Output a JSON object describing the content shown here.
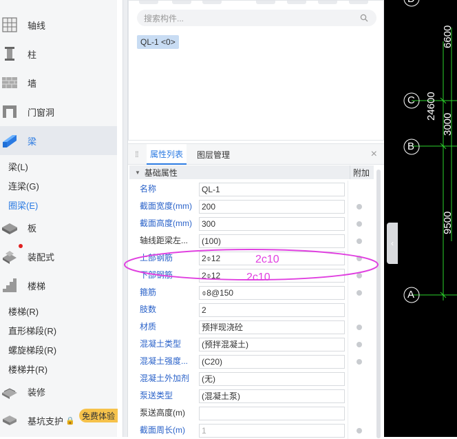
{
  "nav": {
    "items": [
      {
        "label": "轴线",
        "icon": "axis-grid-icon"
      },
      {
        "label": "柱",
        "icon": "column-icon"
      },
      {
        "label": "墙",
        "icon": "wall-icon"
      },
      {
        "label": "门窗洞",
        "icon": "door-window-icon"
      },
      {
        "label": "梁",
        "icon": "beam-icon"
      },
      {
        "label": "板",
        "icon": "slab-icon"
      },
      {
        "label": "装配式",
        "icon": "prefab-icon"
      },
      {
        "label": "楼梯",
        "icon": "stairs-icon"
      },
      {
        "label": "装修",
        "icon": "decoration-icon"
      },
      {
        "label": "基坑支护",
        "icon": "pit-support-icon"
      }
    ],
    "beam_subs": [
      "梁(L)",
      "连梁(G)",
      "圈梁(E)"
    ],
    "stair_subs": [
      "楼梯(R)",
      "直形梯段(R)",
      "螺旋梯段(R)",
      "楼梯井(R)"
    ],
    "lock_glyph": "🔒",
    "free_badge": "免费体验"
  },
  "component_panel": {
    "search_placeholder": "搜索构件...",
    "item": "QL-1 <0>"
  },
  "properties": {
    "tabs": [
      "属性列表",
      "图层管理"
    ],
    "close": "×",
    "group_label": "基础属性",
    "extra_col": "附加",
    "rows": [
      {
        "label": "名称",
        "value": "QL-1",
        "check": false,
        "dark": false
      },
      {
        "label": "截面宽度(mm)",
        "value": "200",
        "check": true,
        "dark": false
      },
      {
        "label": "截面高度(mm)",
        "value": "300",
        "check": true,
        "dark": false
      },
      {
        "label": "轴线距梁左...",
        "value": "(100)",
        "check": true,
        "dark": true
      },
      {
        "label": "上部钢筋",
        "value": "2⌽12",
        "check": true,
        "dark": false
      },
      {
        "label": "下部钢筋",
        "value": "2⌽12",
        "check": true,
        "dark": false
      },
      {
        "label": "箍筋",
        "value": "⌽8@150",
        "check": true,
        "dark": false
      },
      {
        "label": "肢数",
        "value": "2",
        "check": false,
        "dark": false
      },
      {
        "label": "材质",
        "value": "预拌现浇砼",
        "check": true,
        "dark": false
      },
      {
        "label": "混凝土类型",
        "value": "(预拌混凝土)",
        "check": true,
        "dark": false
      },
      {
        "label": "混凝土强度...",
        "value": "(C20)",
        "check": true,
        "dark": false
      },
      {
        "label": "混凝土外加剂",
        "value": "(无)",
        "check": false,
        "dark": false
      },
      {
        "label": "泵送类型",
        "value": "(混凝土泵)",
        "check": false,
        "dark": false
      },
      {
        "label": "泵送高度(m)",
        "value": "",
        "check": false,
        "dark": true
      },
      {
        "label": "截面周长(m)",
        "value": "1",
        "check": true,
        "dark": false
      }
    ]
  },
  "annotations": {
    "top": "2c10",
    "bottom": "2c10",
    "color": "#e040e0"
  },
  "cad": {
    "axis_labels": [
      "D",
      "C",
      "B",
      "A"
    ],
    "dims": [
      "6600",
      "24600",
      "3000",
      "9500"
    ]
  }
}
